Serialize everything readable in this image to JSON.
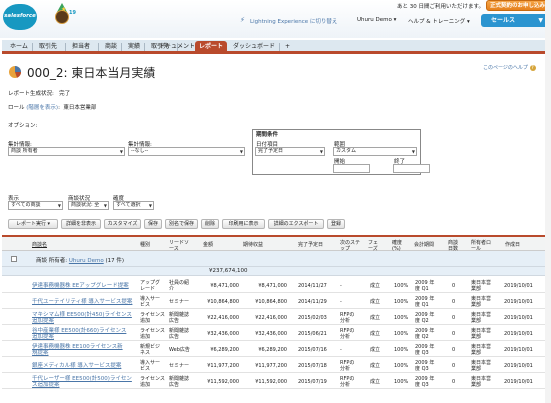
{
  "header": {
    "trial_text": "あと 30 日間ご利用いただけます。",
    "trial_button": "正式契約のお申し込み",
    "release_text": "19",
    "lightning_link": "Lightning Experience に切り替え",
    "user_menu": "Uhuru Demo ▾",
    "help_link": "ヘルプ & トレーニング ▾",
    "app_switcher": "セールス",
    "brand": "salesforce"
  },
  "tabs": [
    "ホーム",
    "取引先",
    "担当者",
    "商談",
    "実績",
    "取引先",
    "ドキュメント",
    "レポート",
    "ダッシュボード",
    "+"
  ],
  "tabs_fixed": [
    "ホーム",
    "取引先",
    "担当者",
    "商談",
    "実績",
    "取引先",
    "ドキュメント",
    "レポート",
    "ダッシュボード",
    "+"
  ],
  "page": {
    "title": "000_2: 東日本当月実績",
    "help": "このページのヘルプ",
    "status_label": "レポート生成状況:",
    "status_value": "完了",
    "role_label": "ロール",
    "role_link": "(階層を表示)",
    "role_colon": ":",
    "role_value": "東日本営業部",
    "options_label": "オプション:"
  },
  "filters": {
    "summary1_label": "集計情報:",
    "summary1_value": "商談 所有者",
    "summary2_label": "集計情報:",
    "summary2_value": "--なし--",
    "period_title": "期間条件",
    "date_field_label": "日付項目",
    "date_field_value": "完了予定日",
    "range_label": "範囲",
    "range_value": "カスタム",
    "start_label": "開始",
    "end_label": "終了",
    "show_label": "表示",
    "show_value": "すべての商談",
    "stage_label": "商談状況",
    "stage_value": "商談状況: 全",
    "prob_label": "確度",
    "prob_value": "すべて選択"
  },
  "toolbar": [
    "レポート実行 ▾",
    "詳細を非表示",
    "カスタマイズ",
    "保存",
    "別名で保存",
    "削除",
    "印刷用に表示",
    "詳細のエクスポート",
    "登録"
  ],
  "table": {
    "headers": [
      "商談名",
      "種別",
      "リードソース",
      "金額",
      "期待収益",
      "完了予定日",
      "次のステップ",
      "フェーズ",
      "確度(%)",
      "会計期間",
      "商談日数",
      "所有者ロール",
      "作成日"
    ],
    "group_label": "商談 所有者:",
    "group_user": "Uhuru Demo",
    "group_count": "(17 件)",
    "group_total": "¥237,674,100",
    "rows": [
      {
        "name": "伊達事務機器株 EEアップグレード提案",
        "type": "アップグ\nレード",
        "source": "社員の紹\n介",
        "amount": "¥8,471,000",
        "expected": "¥8,471,000",
        "close": "2014/11/27",
        "next": "-",
        "stage": "成立",
        "prob": "100%",
        "period": "2009 年\n度 Q1",
        "age": "0",
        "role": "東日本営\n業部",
        "created": "2019/10/01"
      },
      {
        "name": "千代ユーテイリティ様 導入サービス提案",
        "type": "導入サー\nビス",
        "source": "セミナー",
        "amount": "¥10,864,800",
        "expected": "¥10,864,800",
        "close": "2014/11/29",
        "next": "-",
        "stage": "成立",
        "prob": "100%",
        "period": "2009 年\n度 Q1",
        "age": "0",
        "role": "東日本営\n業部",
        "created": "2019/10/01"
      },
      {
        "name": "マキシマム様 EE500(計450)ライセンス\n追加提案",
        "type": "ライセンス\n追加",
        "source": "新聞雑誌\n広告",
        "amount": "¥22,416,000",
        "expected": "¥22,416,000",
        "close": "2015/02/03",
        "next": "RFPの\n分析",
        "stage": "成立",
        "prob": "100%",
        "period": "2009 年\n度 Q2",
        "age": "0",
        "role": "東日本営\n業部",
        "created": "2019/10/01"
      },
      {
        "name": "谷中産業様 EE500(計660)ライセンス\n追加提案",
        "type": "ライセンス\n追加",
        "source": "新聞雑誌\n広告",
        "amount": "¥32,436,000",
        "expected": "¥32,436,000",
        "close": "2015/06/21",
        "next": "RFPの\n分析",
        "stage": "成立",
        "prob": "100%",
        "period": "2009 年\n度 Q2",
        "age": "0",
        "role": "東日本営\n業部",
        "created": "2019/10/01"
      },
      {
        "name": "伊達事務機器株 EE100ライセンス新\n規提案",
        "type": "新規ビジ\nネス",
        "source": "Web広告",
        "amount": "¥6,289,200",
        "expected": "¥6,289,200",
        "close": "2015/07/16",
        "next": "-",
        "stage": "成立",
        "prob": "100%",
        "period": "2009 年\n度 Q3",
        "age": "0",
        "role": "東日本営\n業部",
        "created": "2019/10/01"
      },
      {
        "name": "銀座メディカル様 導入サービス提案",
        "type": "導入サー\nビス",
        "source": "セミナー",
        "amount": "¥11,977,200",
        "expected": "¥11,977,200",
        "close": "2015/07/18",
        "next": "RFPの\n分析",
        "stage": "成立",
        "prob": "100%",
        "period": "2009 年\n度 Q3",
        "age": "0",
        "role": "東日本営\n業部",
        "created": "2019/10/01"
      },
      {
        "name": "千代レーザー様 EE500(計500)ライセン\nス追加提案",
        "type": "ライセンス\n追加",
        "source": "新聞雑誌\n広告",
        "amount": "¥11,592,000",
        "expected": "¥11,592,000",
        "close": "2015/07/19",
        "next": "RFPの\n分析",
        "stage": "成立",
        "prob": "100%",
        "period": "2009 年\n度 Q3",
        "age": "0",
        "role": "東日本営\n業部",
        "created": "2019/10/01"
      }
    ]
  },
  "colors": {
    "accent": "#b94a2c",
    "link": "#4a76a8",
    "brand": "#1798c1"
  }
}
